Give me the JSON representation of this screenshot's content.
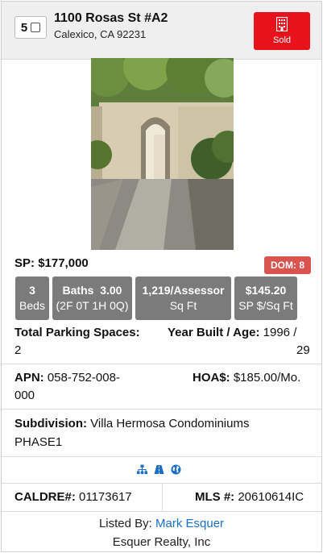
{
  "header": {
    "index": "5",
    "address_line1": "1100 Rosas St #A2",
    "address_line2": "Calexico, CA 92231",
    "status_label": "Sold",
    "status_color": "#e8121b"
  },
  "listing": {
    "sp_label": "SP:",
    "sp_value": "$177,000",
    "dom_label": "DOM:",
    "dom_value": "8",
    "stats": [
      {
        "top": "3",
        "bottom": "Beds"
      },
      {
        "top": "Baths  3.00",
        "bottom": "(2F 0T 1H 0Q)"
      },
      {
        "top": "1,219/Assessor",
        "bottom": "Sq Ft"
      },
      {
        "top": "$145.20",
        "bottom": "SP $/Sq Ft"
      }
    ],
    "parking_label": "Total Parking Spaces:",
    "parking_value": "2",
    "year_label": "Year Built / Age:",
    "year_value": "1996 /",
    "age_value": "29",
    "apn_label": "APN:",
    "apn_value_1": "058-752-008-",
    "apn_value_2": "000",
    "hoa_label": "HOA$:",
    "hoa_value": "$185.00/Mo.",
    "subdivision_label": "Subdivision:",
    "subdivision_value_1": "Villa Hermosa Condominiums",
    "subdivision_value_2": "PHASE1",
    "icons": [
      "sitemap-icon",
      "road-icon",
      "globe-icon"
    ],
    "caldre_label": "CALDRE#:",
    "caldre_value": "01173617",
    "mls_label": "MLS #:",
    "mls_value": "20610614IC",
    "listed_by_label": "Listed By:",
    "agent_name": "Mark Esquer",
    "office_name": "Esquer Realty, Inc"
  },
  "colors": {
    "stat_bg": "#7b7b7b",
    "dom_bg": "#d9534f",
    "link": "#1a6fc4",
    "icon_blue": "#1a6fc4"
  }
}
